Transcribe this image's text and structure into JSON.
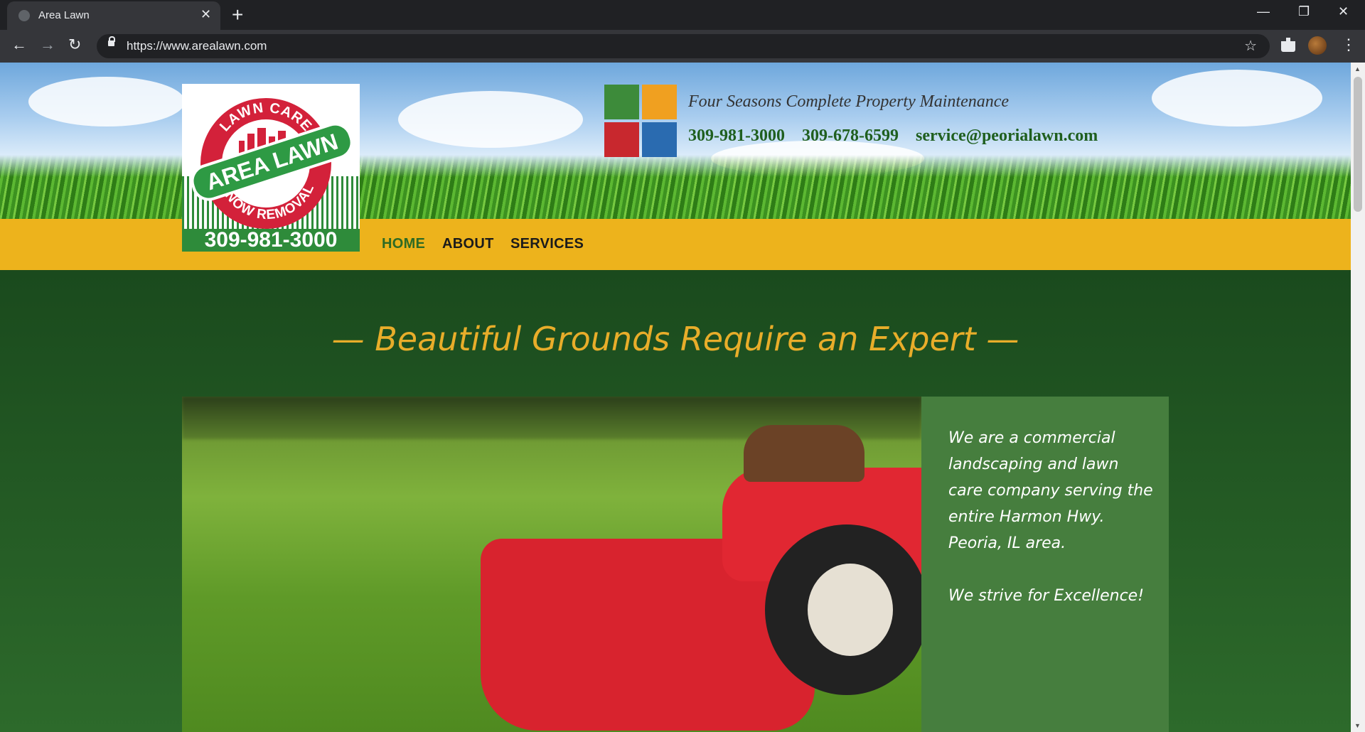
{
  "browser": {
    "tab_title": "Area Lawn",
    "url": "https://www.arealawn.com",
    "new_tab_glyph": "+",
    "close_glyph": "✕"
  },
  "logo": {
    "top_arc": "LAWN CARE",
    "banner": "AREA LAWN",
    "bottom_arc": "SNOW REMOVAL",
    "phone": "309-981-3000"
  },
  "header": {
    "tagline": "Four Seasons Complete Property Maintenance",
    "phone1": "309-981-3000",
    "phone2": "309-678-6599",
    "email": "service@peorialawn.com"
  },
  "nav": {
    "items": [
      {
        "label": "HOME"
      },
      {
        "label": "ABOUT"
      },
      {
        "label": "SERVICES"
      }
    ]
  },
  "main": {
    "headline": "— Beautiful Grounds Require an Expert —",
    "info_paragraph1": "We are a commercial landscaping and lawn care company serving the entire Harmon Hwy. Peoria, IL area.",
    "info_paragraph2": "We strive for Excellence!"
  },
  "colors": {
    "nav_bg": "#edb31c",
    "main_bg": "#1b4a1e",
    "headline": "#e8ad2a",
    "logo_red": "#d3213a",
    "logo_green": "#2e8b3a"
  }
}
